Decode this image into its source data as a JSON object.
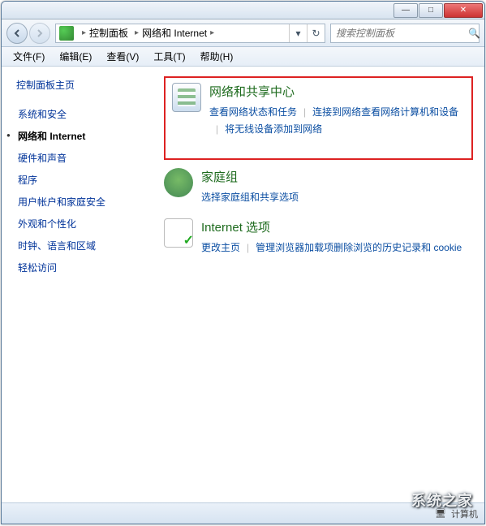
{
  "titlebar": {
    "min": "—",
    "max": "□",
    "close": "✕"
  },
  "address": {
    "crumb1": "控制面板",
    "crumb2": "网络和 Internet"
  },
  "search": {
    "placeholder": "搜索控制面板"
  },
  "menu": {
    "file": "文件(F)",
    "edit": "编辑(E)",
    "view": "查看(V)",
    "tools": "工具(T)",
    "help": "帮助(H)"
  },
  "sidebar": {
    "home": "控制面板主页",
    "items": [
      {
        "label": "系统和安全"
      },
      {
        "label": "网络和 Internet",
        "active": true
      },
      {
        "label": "硬件和声音"
      },
      {
        "label": "程序"
      },
      {
        "label": "用户帐户和家庭安全"
      },
      {
        "label": "外观和个性化"
      },
      {
        "label": "时钟、语言和区域"
      },
      {
        "label": "轻松访问"
      }
    ]
  },
  "sections": {
    "network": {
      "title": "网络和共享中心",
      "links": [
        "查看网络状态和任务",
        "连接到网络",
        "查看网络计算机和设备",
        "将无线设备添加到网络"
      ]
    },
    "homegroup": {
      "title": "家庭组",
      "links": [
        "选择家庭组和共享选项"
      ]
    },
    "internet": {
      "title": "Internet 选项",
      "links": [
        "更改主页",
        "管理浏览器加载项",
        "删除浏览的历史记录和 cookie"
      ]
    }
  },
  "status": {
    "label": "计算机"
  },
  "watermark": "系统之家"
}
